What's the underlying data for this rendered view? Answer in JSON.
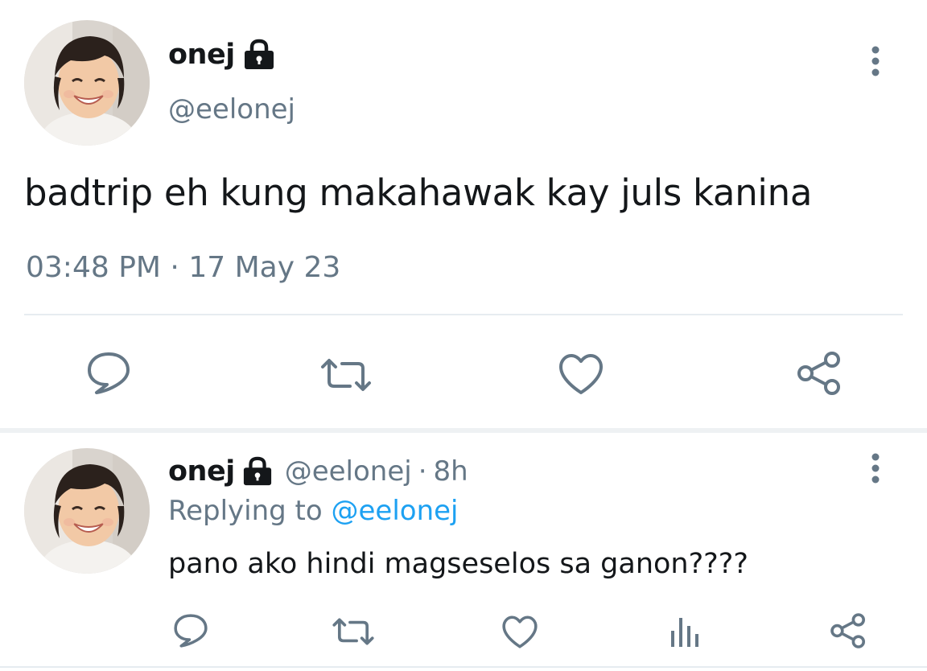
{
  "main_tweet": {
    "display_name": "onej",
    "handle": "@eelonej",
    "text": "badtrip eh kung makahawak kay juls kanina",
    "time": "03:48 PM",
    "separator": "·",
    "date": "17 May 23",
    "icons": [
      "avatar",
      "lock-icon",
      "more-vertical-icon",
      "reply-icon",
      "retweet-icon",
      "like-icon",
      "share-icon"
    ]
  },
  "reply_tweet": {
    "display_name": "onej",
    "handle": "@eelonej",
    "separator": "·",
    "age": "8h",
    "replying_label": "Replying to",
    "replying_to": "@eelonej",
    "text": "pano ako hindi magseselos sa ganon????",
    "icons": [
      "avatar",
      "lock-icon",
      "more-vertical-icon",
      "reply-icon",
      "retweet-icon",
      "like-icon",
      "analytics-icon",
      "share-icon"
    ]
  },
  "colors": {
    "text_primary": "#14171a",
    "text_secondary": "#657786",
    "link": "#1da1f2",
    "divider": "#e6ecf0"
  }
}
